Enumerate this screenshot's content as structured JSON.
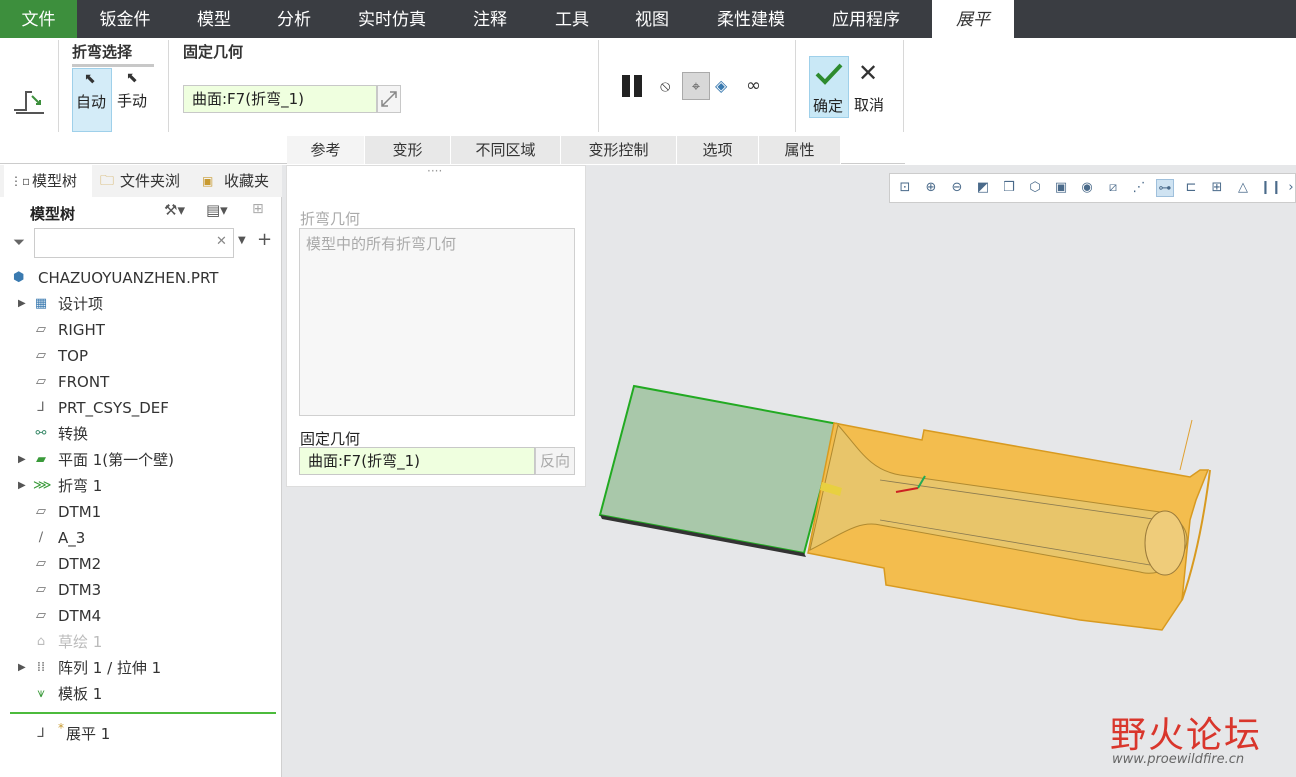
{
  "menu": {
    "file": "文件",
    "items": [
      "钣金件",
      "模型",
      "分析",
      "实时仿真",
      "注释",
      "工具",
      "视图",
      "柔性建模",
      "应用程序"
    ],
    "active": "展平"
  },
  "ribbon": {
    "bend_select_title": "折弯选择",
    "auto_label": "自动",
    "manual_label": "手动",
    "fixed_geom_title": "固定几何",
    "fixed_geom_value": "曲面:F7(折弯_1)",
    "ok_label": "确定",
    "cancel_label": "取消",
    "tabs": [
      "参考",
      "变形",
      "不同区域",
      "变形控制",
      "选项",
      "属性"
    ]
  },
  "left_panel": {
    "tabs": [
      "模型树",
      "文件夹浏",
      "收藏夹"
    ],
    "tree_title": "模型树",
    "filter_placeholder": "",
    "root": "CHAZUOYUANZHEN.PRT",
    "items": [
      {
        "label": "设计项",
        "expand": true
      },
      {
        "label": "RIGHT",
        "expand": false
      },
      {
        "label": "TOP",
        "expand": false
      },
      {
        "label": "FRONT",
        "expand": false
      },
      {
        "label": "PRT_CSYS_DEF",
        "expand": false
      },
      {
        "label": "转换",
        "expand": false
      },
      {
        "label": "平面 1(第一个壁)",
        "expand": true
      },
      {
        "label": "折弯 1",
        "expand": true
      },
      {
        "label": "DTM1",
        "expand": false
      },
      {
        "label": "A_3",
        "expand": false
      },
      {
        "label": "DTM2",
        "expand": false
      },
      {
        "label": "DTM3",
        "expand": false
      },
      {
        "label": "DTM4",
        "expand": false
      },
      {
        "label": "草绘 1",
        "expand": false,
        "dim": true
      },
      {
        "label": "阵列 1 / 拉伸 1",
        "expand": true
      },
      {
        "label": "模板 1",
        "expand": false
      }
    ],
    "insert_item_mark": "*",
    "insert_item": "展平 1"
  },
  "dashboard": {
    "bend_geom_label": "折弯几何",
    "bend_geom_value": "模型中的所有折弯几何",
    "fixed_geom_label": "固定几何",
    "fixed_geom_value": "曲面:F7(折弯_1)",
    "reverse_label": "反向",
    "handle": "····"
  },
  "watermark": {
    "title": "野火论坛",
    "url": "www.proewildfire.cn"
  },
  "colors": {
    "menu_bg": "#3a3d42",
    "file_bg": "#3d8f3d",
    "field_green": "#efffdf",
    "part_orange": "#f3bd4e",
    "fixed_face": "#a8c8a8"
  }
}
